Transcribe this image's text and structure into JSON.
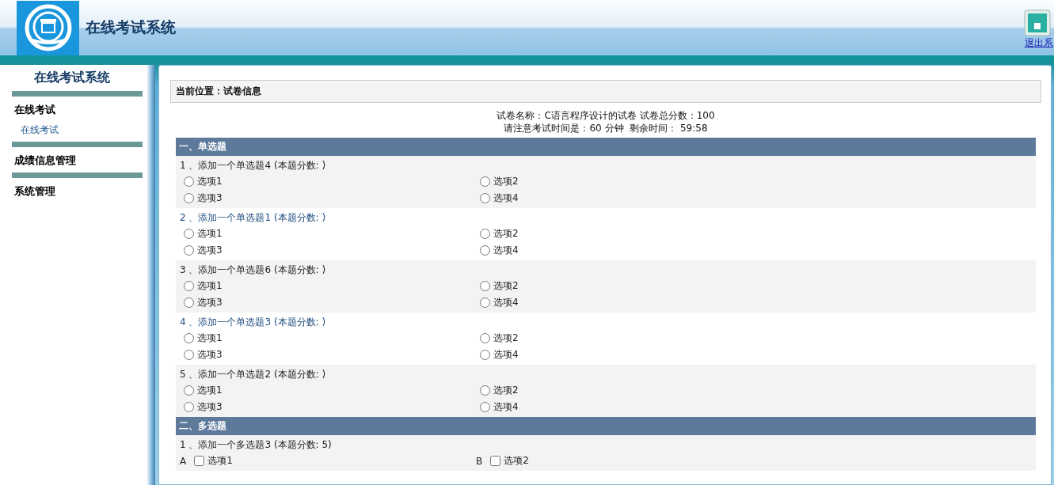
{
  "header": {
    "title": "在线考试系统",
    "logout": "退出系"
  },
  "sidebar": {
    "title": "在线考试系统",
    "groups": [
      {
        "label": "在线考试",
        "children": [
          {
            "label": "在线考试"
          }
        ]
      },
      {
        "label": "成绩信息管理"
      },
      {
        "label": "系统管理"
      }
    ]
  },
  "breadcrumb": "当前位置：试卷信息",
  "paper_info": [
    "试卷名称：C语言程序设计的试卷 试卷总分数：100",
    "请注意考试时间是：60 分钟  剩余时间： 59:58"
  ],
  "sections": [
    {
      "title": "一、单选题",
      "questions": [
        {
          "kind": "radio",
          "title": "1 、添加一个单选题4 (本题分数: )",
          "options": [
            {
              "label": "选项1",
              "selected": false
            },
            {
              "label": "选项2",
              "selected": false
            },
            {
              "label": "选项3",
              "selected": false
            },
            {
              "label": "选项4",
              "selected": false
            }
          ]
        },
        {
          "kind": "radio",
          "title": "2 、添加一个单选题1 (本题分数: )",
          "options": [
            {
              "label": "选项1",
              "selected": false
            },
            {
              "label": "选项2",
              "selected": false
            },
            {
              "label": "选项3",
              "selected": false
            },
            {
              "label": "选项4",
              "selected": false
            }
          ]
        },
        {
          "kind": "radio",
          "title": "3 、添加一个单选题6 (本题分数: )",
          "options": [
            {
              "label": "选项1",
              "selected": false
            },
            {
              "label": "选项2",
              "selected": false
            },
            {
              "label": "选项3",
              "selected": false
            },
            {
              "label": "选项4",
              "selected": false
            }
          ]
        },
        {
          "kind": "radio",
          "title": "4 、添加一个单选题3 (本题分数: )",
          "options": [
            {
              "label": "选项1",
              "selected": false
            },
            {
              "label": "选项2",
              "selected": false
            },
            {
              "label": "选项3",
              "selected": false
            },
            {
              "label": "选项4",
              "selected": false
            }
          ]
        },
        {
          "kind": "radio",
          "title": "5 、添加一个单选题2 (本题分数: )",
          "options": [
            {
              "label": "选项1",
              "selected": false
            },
            {
              "label": "选项2",
              "selected": false
            },
            {
              "label": "选项3",
              "selected": false
            },
            {
              "label": "选项4",
              "selected": false
            }
          ]
        }
      ]
    },
    {
      "title": "二、多选题",
      "questions": [
        {
          "kind": "checkbox",
          "title": "1 、添加一个多选题3 (本题分数: 5)",
          "options": [
            {
              "letter": "A",
              "label": "选项1",
              "checked": false
            },
            {
              "letter": "B",
              "label": "选项2",
              "checked": false
            }
          ]
        }
      ]
    }
  ]
}
